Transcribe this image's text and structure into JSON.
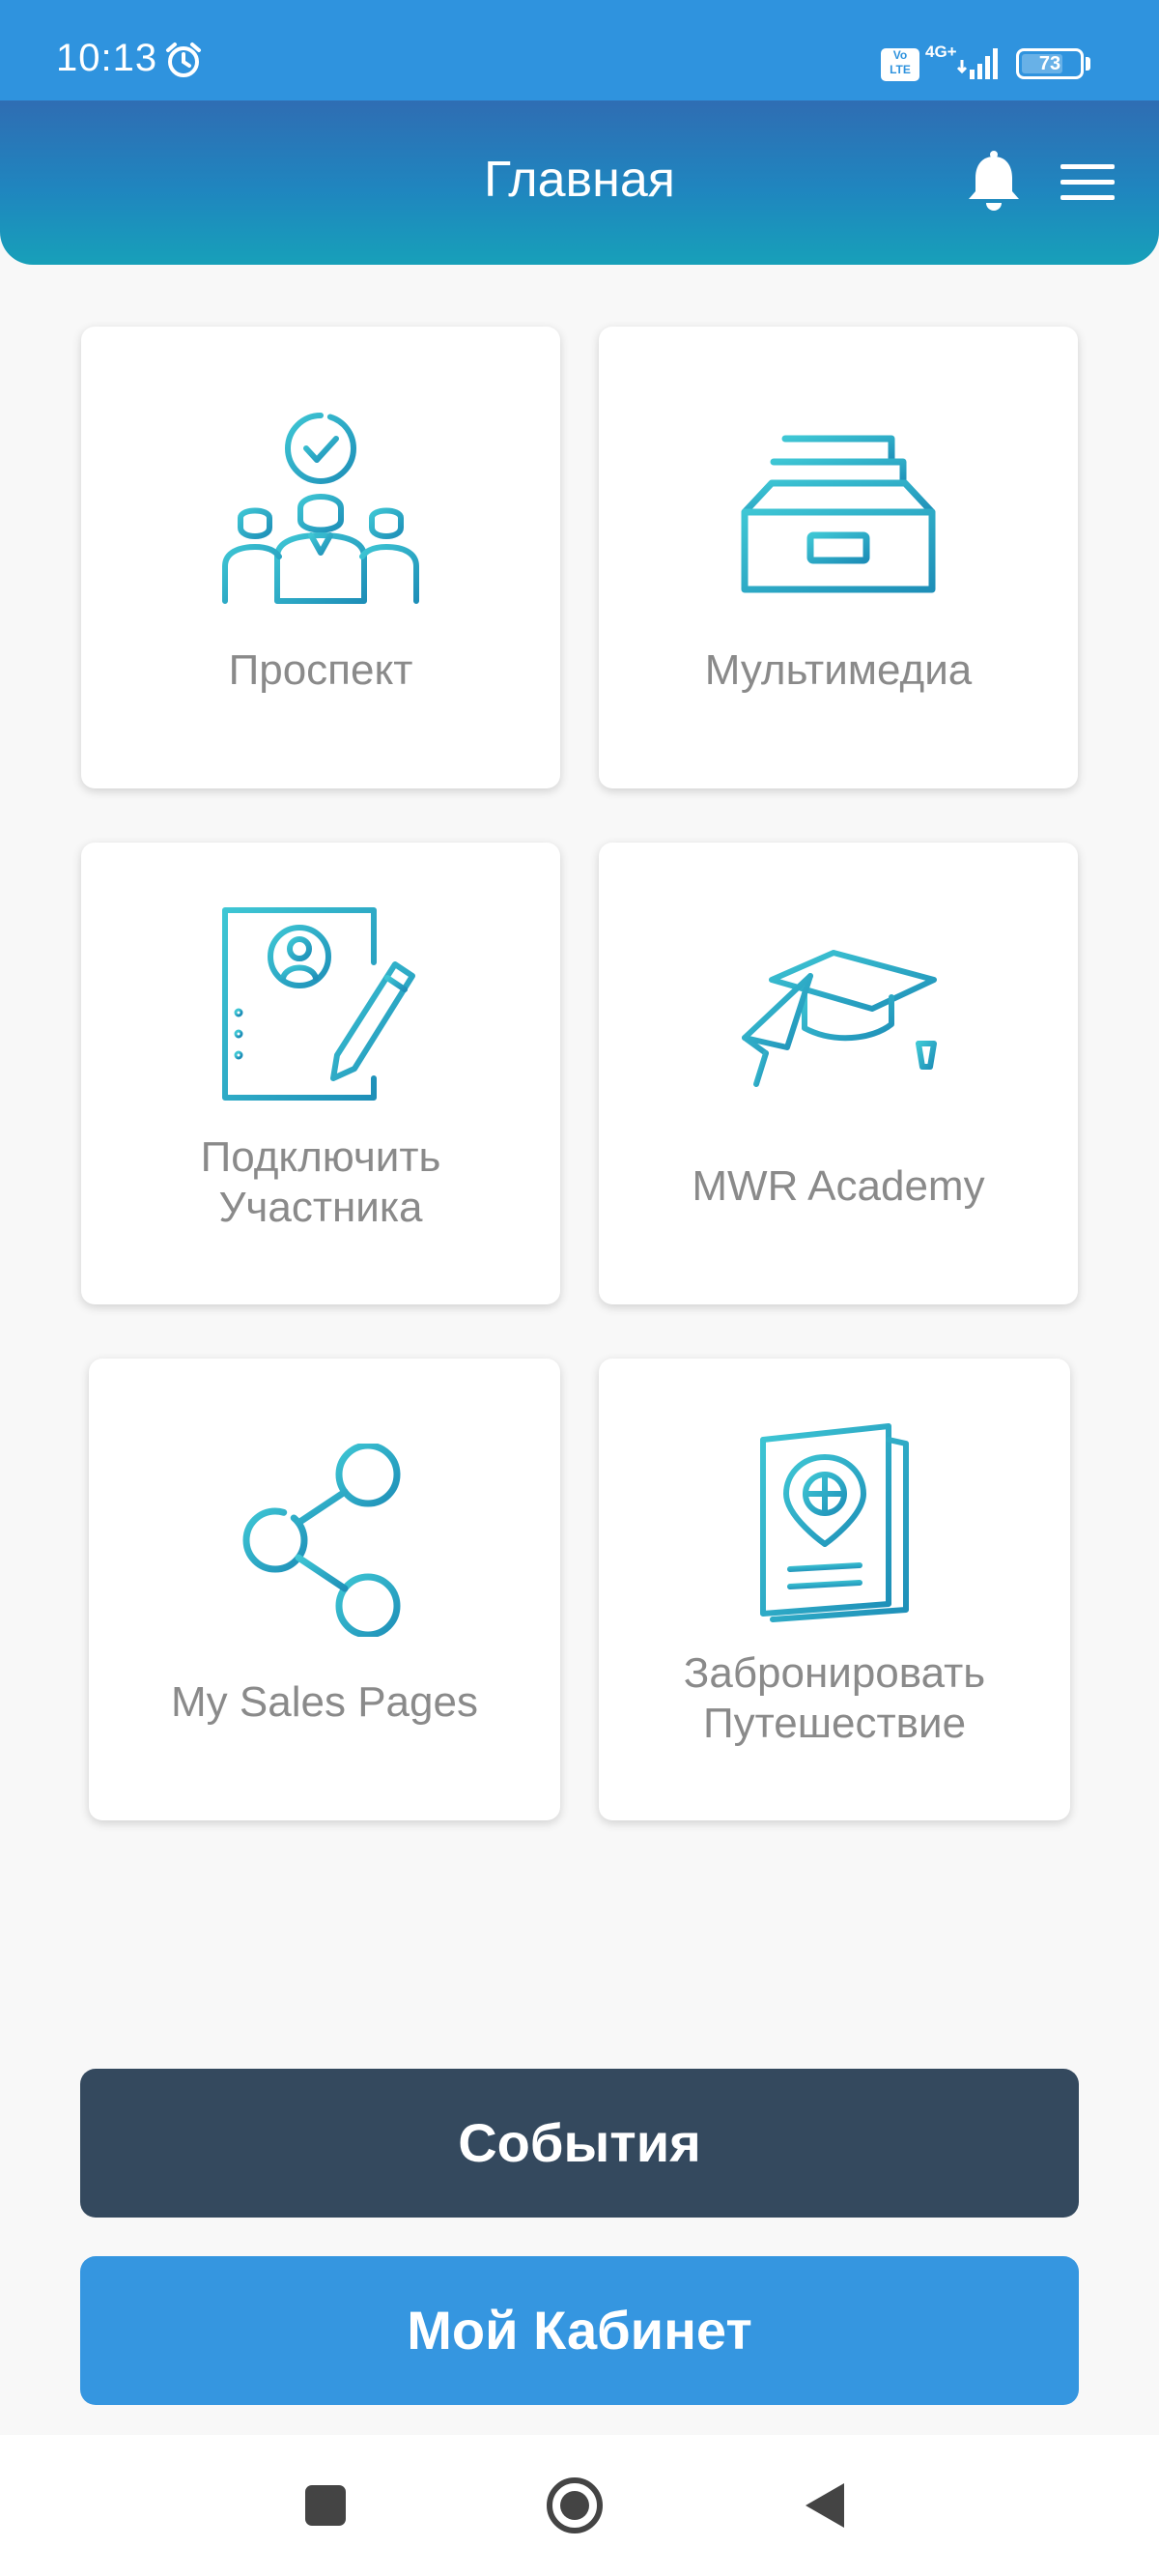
{
  "status_bar": {
    "time": "10:13",
    "volte_line1": "Vo",
    "volte_line2": "LTE",
    "network": "4G+",
    "battery_level": "73",
    "battery_fraction": 0.73
  },
  "header": {
    "title": "Главная"
  },
  "tiles": [
    {
      "label": "Проспект",
      "icon": "prospect-team-check-icon"
    },
    {
      "label": "Мультимедиа",
      "icon": "archive-drawer-icon"
    },
    {
      "label_line1": "Подключить",
      "label_line2": "Участника",
      "icon": "document-pen-icon"
    },
    {
      "label": "MWR Academy",
      "icon": "graduation-cap-icon"
    },
    {
      "label": "My Sales Pages",
      "icon": "share-icon"
    },
    {
      "label_line1": "Забронировать",
      "label_line2": "Путешествие",
      "icon": "passport-icon"
    }
  ],
  "buttons": {
    "events": "События",
    "cabinet": "Мой Кабинет"
  },
  "colors": {
    "status_bar": "#2f93de",
    "header_gradient_top": "#2f6db3",
    "header_gradient_bottom": "#17a0b9",
    "icon_gradient_start": "#3ec6d4",
    "icon_gradient_end": "#1e8fb8",
    "events_button": "#34495e",
    "cabinet_button": "#3596e0",
    "tile_label": "#8a8a8a"
  }
}
